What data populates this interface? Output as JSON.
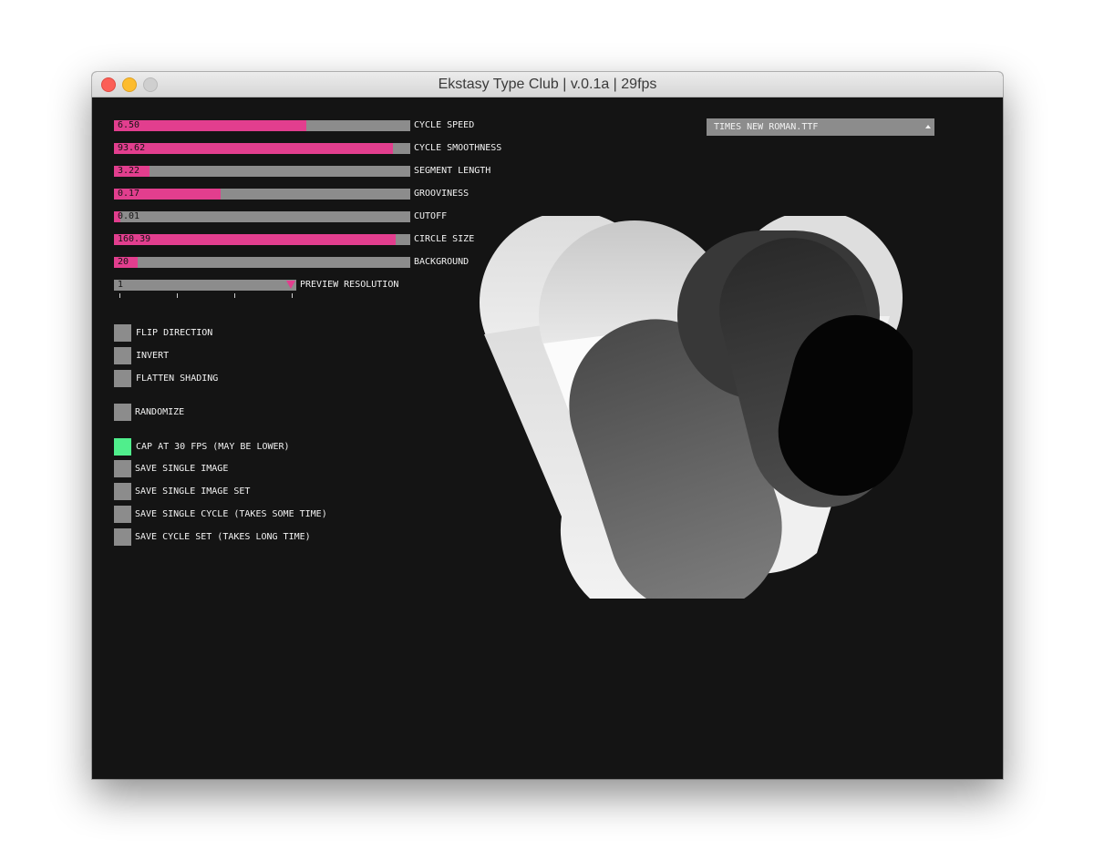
{
  "window": {
    "title": "Ekstasy Type Club | v.0.1a | 29fps"
  },
  "sliders": [
    {
      "value_text": "6.50",
      "label": "CYCLE SPEED",
      "fraction": 0.65
    },
    {
      "value_text": "93.62",
      "label": "CYCLE SMOOTHNESS",
      "fraction": 0.943
    },
    {
      "value_text": "3.22",
      "label": "SEGMENT LENGTH",
      "fraction": 0.12
    },
    {
      "value_text": "0.17",
      "label": "GROOVINESS",
      "fraction": 0.36
    },
    {
      "value_text": "0.01",
      "label": "CUTOFF",
      "fraction": 0.02
    },
    {
      "value_text": "160.39",
      "label": "CIRCLE SIZE",
      "fraction": 0.952
    },
    {
      "value_text": "20",
      "label": "BACKGROUND",
      "fraction": 0.08
    }
  ],
  "preview_resolution": {
    "value_text": "1",
    "label": "PREVIEW RESOLUTION"
  },
  "toggles": [
    {
      "label": "FLIP DIRECTION",
      "checked": false
    },
    {
      "label": "INVERT",
      "checked": false
    },
    {
      "label": "FLATTEN SHADING",
      "checked": false
    }
  ],
  "randomize": {
    "label": "RANDOMIZE",
    "checked": false
  },
  "actions": [
    {
      "label": "CAP AT 30 FPS (MAY BE LOWER)",
      "checked": true
    },
    {
      "label": "SAVE SINGLE IMAGE",
      "checked": false
    },
    {
      "label": "SAVE SINGLE IMAGE SET",
      "checked": false
    },
    {
      "label": "SAVE SINGLE CYCLE (TAKES SOME TIME)",
      "checked": false
    },
    {
      "label": "SAVE CYCLE SET (TAKES LONG TIME)",
      "checked": false
    }
  ],
  "font_dropdown": {
    "selected": "TIMES NEW ROMAN.TTF"
  },
  "colors": {
    "accent": "#e23e8e",
    "track": "#8c8c8c",
    "checked": "#50ee8c",
    "background": "#141414"
  },
  "icons": {
    "close": "close-dot-icon",
    "minimize": "minimize-dot-icon",
    "maximize": "maximize-dot-icon",
    "dropdown": "caret-up-icon",
    "preview_marker": "triangle-down-icon"
  }
}
